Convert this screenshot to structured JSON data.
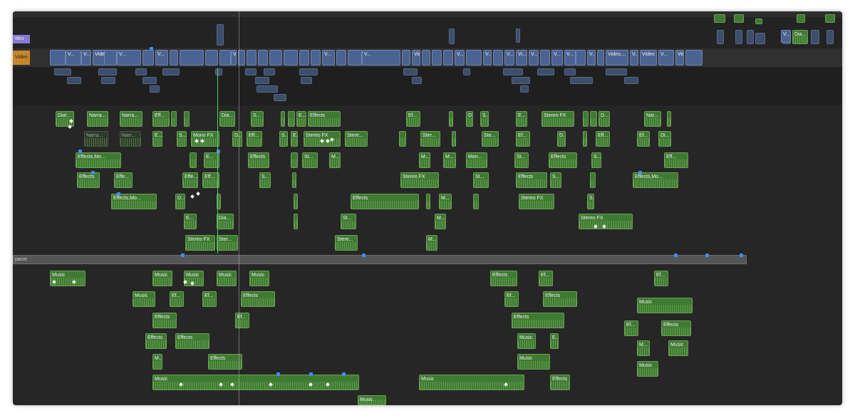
{
  "lanes": {
    "titles_label": "itles",
    "video_label": "Video",
    "spacer_label": "pacer"
  },
  "colors": {
    "background": "#262626",
    "audio_clip": "#3f7a33",
    "video_clip": "#4a6390",
    "title_lane": "#8a7ad6",
    "video_lane": "#c8862c",
    "marker": "#3f8ef0"
  },
  "primary_clip_labels": [
    "V...",
    "V...",
    "Video",
    "V...",
    "V...",
    "V...",
    "V...",
    "V...",
    "Video,Dialo...",
    "V...",
    "V...",
    "V...",
    "Vi...",
    "V...",
    "V...",
    "V...",
    "V...",
    "Video,...",
    "V...",
    "Video",
    "V...",
    "Video"
  ],
  "audio_clip_labels": [
    "Dial...",
    "Narra...",
    "Narra...",
    "Eff...",
    "Dia...",
    "S...",
    "E...",
    "Effects",
    "Ef...",
    "D...",
    "S...",
    "E...",
    "Stereo FX",
    "D...",
    "Nar...",
    "Narra...",
    "Narr...",
    "E...",
    "S...",
    "Mono FX",
    "D...",
    "Eff...",
    "S...",
    "E...",
    "Stereo FX",
    "Stere...",
    "Ster...",
    "Ste...",
    "Ef...",
    "D...",
    "Eff...",
    "Ef...",
    "Di...",
    "Effects,Mo...",
    "E...",
    "Effects",
    "St...",
    "M...",
    "M...",
    "M...",
    "Mon...",
    "St...",
    "Effects",
    "S...",
    "Eff...",
    "Effects",
    "Effe...",
    "Effe...",
    "Eff...",
    "S...",
    "Stereo FX",
    "St...",
    "Effects",
    "S...",
    "Effects,Mo...",
    "Effects,Mo...",
    "D...",
    "Effects",
    "M...",
    "Stereo FX",
    "S...",
    "E...",
    "Dia...",
    "St...",
    "M...",
    "Stereo FX",
    "Stereo FX",
    "Ster...",
    "Stere...",
    "M...",
    "Music",
    "Music",
    "Music",
    "Music",
    "Music",
    "Effects",
    "Ef...",
    "Ef...",
    "Music",
    "Ef...",
    "Ef...",
    "Effects",
    "Ef...",
    "Effects",
    "Music",
    "Effects",
    "Ef...",
    "Effects",
    "Ef...",
    "Effects",
    "Effects",
    "Effects",
    "Music",
    "E...",
    "M...",
    "Music",
    "M...",
    "Effects",
    "Music",
    "Music",
    "Music",
    "Music",
    "Effects",
    "Music"
  ]
}
